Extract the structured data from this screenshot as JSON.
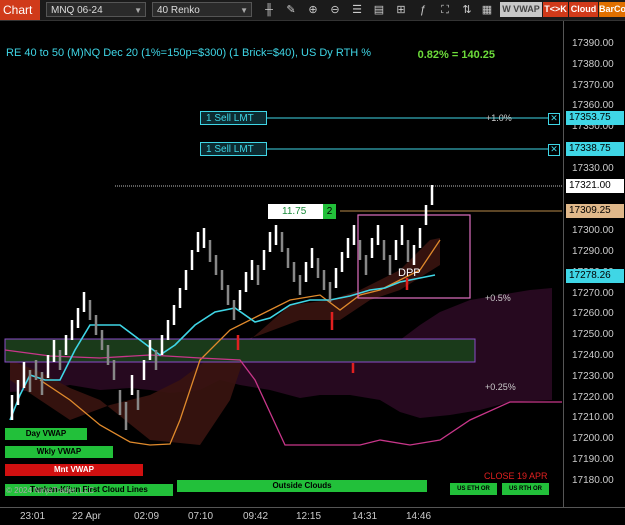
{
  "toolbar": {
    "tab_label": "Chart",
    "instrument": "MNQ 06-24",
    "bar_type": "40 Renko",
    "icons": [
      "bar-style-icon",
      "drawing-icon",
      "zoom-in-icon",
      "zoom-out-icon",
      "properties-icon",
      "templates-icon",
      "strategies-icon",
      "indicators-icon",
      "data-box-icon",
      "trade-icon",
      "chart-trader-icon"
    ],
    "vwap_btn": "W VWAP",
    "tk_btn": "T<>K",
    "cloud_btn": "Cloud",
    "barco_btn": "BarCo"
  },
  "chart": {
    "title": "RE 40 to 50 (M)NQ Dec 20 (1%=150p=$300) (1 Brick=$40), US Dy RTH %",
    "pct_readout": "0.82% = 140.25",
    "price_ticks": [
      "17390.00",
      "17380.00",
      "17370.00",
      "17360.00",
      "17350.00",
      "17340.00",
      "17330.00",
      "17320.00",
      "17310.00",
      "17300.00",
      "17290.00",
      "17280.00",
      "17270.00",
      "17260.00",
      "17250.00",
      "17240.00",
      "17230.00",
      "17220.00",
      "17210.00",
      "17200.00",
      "17190.00",
      "17180.00"
    ],
    "price_tags": {
      "sell1": "17353.75",
      "sell2": "17338.75",
      "last": "17321.00",
      "entry": "17309.25",
      "vwap": "17278.26"
    },
    "time_ticks": [
      "23:01",
      "22 Apr",
      "02:09",
      "07:10",
      "09:42",
      "12:15",
      "14:31",
      "14:46"
    ],
    "orders": [
      {
        "label": "1 Sell LMT"
      },
      {
        "label": "1 Sell LMT"
      }
    ],
    "position": {
      "price": "11.75",
      "qty": "2"
    },
    "annotations": {
      "plus1": "+1.0%",
      "plus05": "+0.5%",
      "plus025": "+0.25%",
      "dpp": "DPP",
      "close": "CLOSE 19 APR"
    },
    "labels": {
      "day_vwap": "Day VWAP",
      "wkly_vwap": "Wkly VWAP",
      "mnt_vwap": "Mnt VWAP",
      "tenkan": "Tenkan-Kijun First Cloud Lines",
      "outside": "Outside Clouds",
      "us_eth1": "US ETH OR",
      "us_rth": "US RTH OR"
    },
    "copyright": "© 2024 NinjaTrader, LLC"
  }
}
